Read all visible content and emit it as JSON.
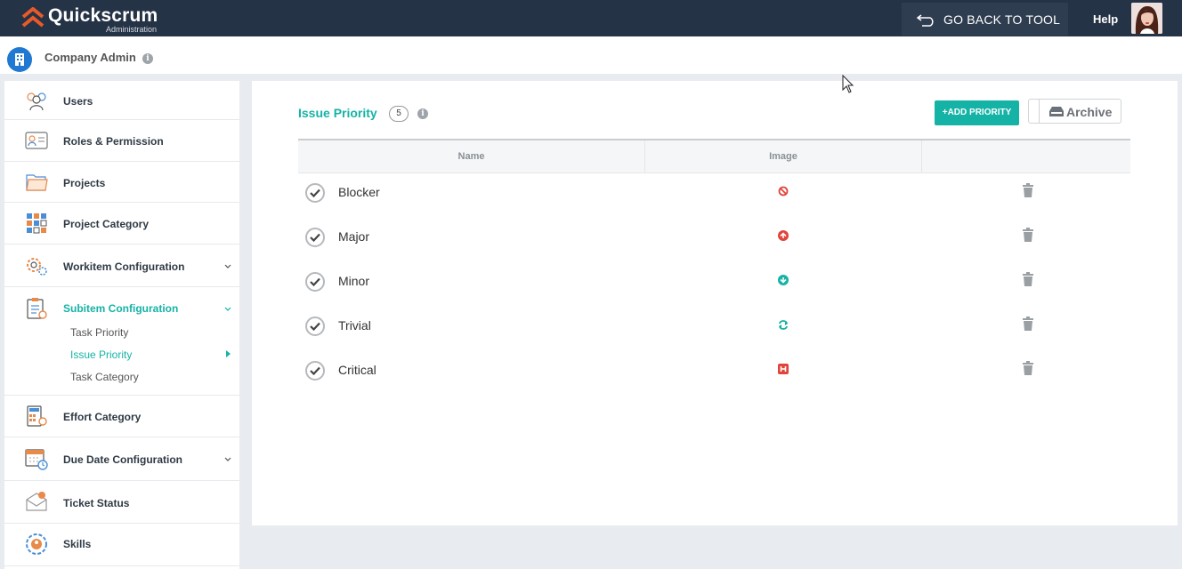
{
  "header": {
    "brand": "Quickscrum",
    "brand_sub": "Administration",
    "go_back_label": "GO BACK TO TOOL",
    "help_label": "Help"
  },
  "company": {
    "name": "Company Admin"
  },
  "sidebar": {
    "items": [
      {
        "label": "Users",
        "icon": "users-icon"
      },
      {
        "label": "Roles & Permission",
        "icon": "id-card-icon"
      },
      {
        "label": "Projects",
        "icon": "folder-icon"
      },
      {
        "label": "Project Category",
        "icon": "grid-icon"
      },
      {
        "label": "Workitem Configuration",
        "icon": "gears-icon",
        "expandable": true
      },
      {
        "label": "Subitem Configuration",
        "icon": "clipboard-icon",
        "expandable": true,
        "active": true,
        "children": [
          {
            "label": "Task Priority"
          },
          {
            "label": "Issue Priority",
            "active": true
          },
          {
            "label": "Task Category"
          }
        ]
      },
      {
        "label": "Effort Category",
        "icon": "calculator-icon"
      },
      {
        "label": "Due Date Configuration",
        "icon": "calendar-clock-icon",
        "expandable": true
      },
      {
        "label": "Ticket Status",
        "icon": "ticket-icon"
      },
      {
        "label": "Skills",
        "icon": "skills-icon"
      }
    ]
  },
  "main": {
    "title": "Issue Priority",
    "count": "5",
    "add_button_label": "ADD PRIORITY",
    "archive_label": "Archive",
    "columns": [
      "Name",
      "Image",
      ""
    ],
    "rows": [
      {
        "name": "Blocker",
        "icon": "blocker-icon",
        "color": "#e0443a"
      },
      {
        "name": "Major",
        "icon": "arrow-up-circle-icon",
        "color": "#e0443a"
      },
      {
        "name": "Minor",
        "icon": "arrow-down-circle-icon",
        "color": "#15b3a6"
      },
      {
        "name": "Trivial",
        "icon": "refresh-icon",
        "color": "#15b3a6"
      },
      {
        "name": "Critical",
        "icon": "hospital-icon",
        "color": "#e0443a"
      }
    ]
  },
  "colors": {
    "accent": "#15b3a6",
    "topbar": "#253346",
    "danger": "#e0443a",
    "brand_orange": "#e85a2a"
  }
}
